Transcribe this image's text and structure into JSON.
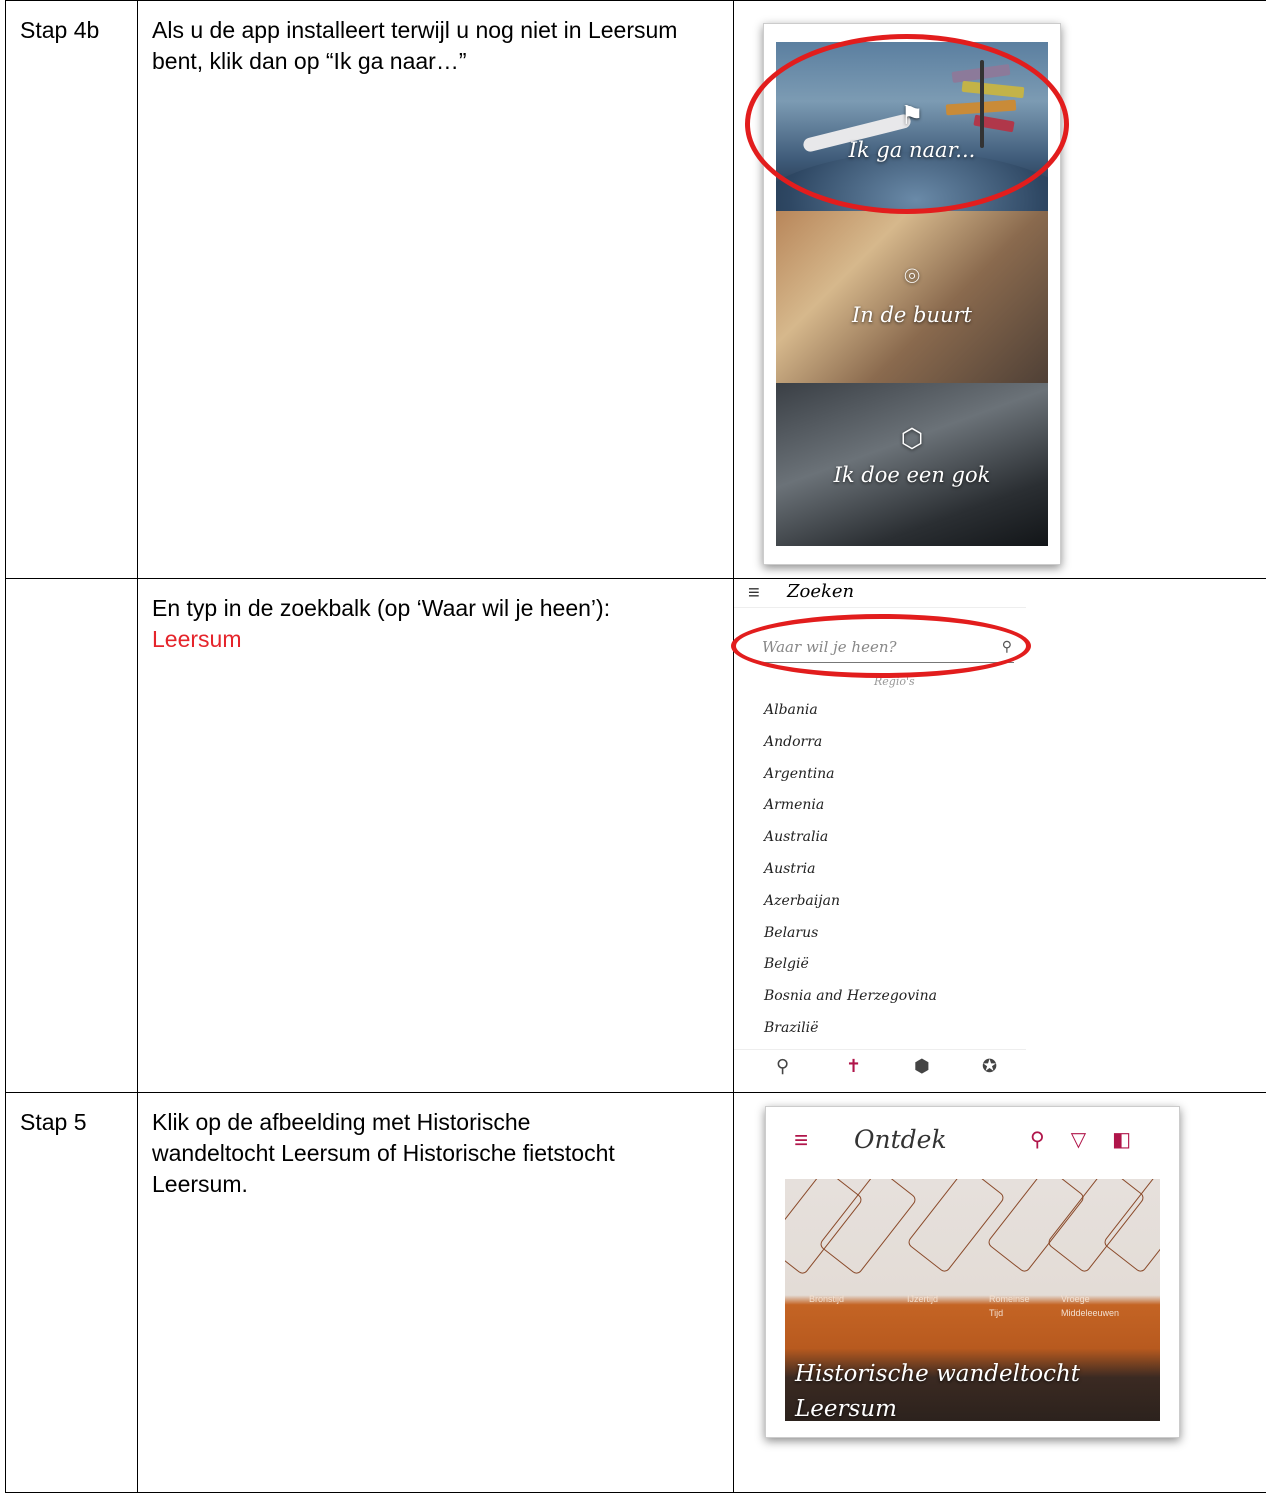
{
  "rows": [
    {
      "step": "Stap 4b",
      "instruction": "Als u de app installeert terwijl u nog niet in Leersum bent, klik dan op “Ik ga naar…”",
      "panels": [
        {
          "label": "Ik ga naar...",
          "icon": "signpost-icon"
        },
        {
          "label": "In de buurt",
          "icon": "location-pin-icon"
        },
        {
          "label": "Ik doe een gok",
          "icon": "dice-icon"
        }
      ]
    },
    {
      "step": "",
      "instruction": "En typ in de zoekbalk (op ‘Waar wil je heen’):",
      "highlight": "Leersum",
      "highlight_color": "#e5242b",
      "screen_title": "Zoeken",
      "search_placeholder": "Waar wil je heen?",
      "section_label": "Regio's",
      "countries": [
        "Albania",
        "Andorra",
        "Argentina",
        "Armenia",
        "Australia",
        "Austria",
        "Azerbaijan",
        "Belarus",
        "België",
        "Bosnia and Herzegovina",
        "Brazilië"
      ]
    },
    {
      "step": "Stap 5",
      "instruction": "Klik op de afbeelding met Historische wandeltocht Leersum of Historische fietstocht Leersum.",
      "screen_title": "Ontdek",
      "eras": [
        "Bronstijd",
        "IJzertijd",
        "Romeinse",
        "Vroege",
        "Tijd",
        "Middeleeuwen"
      ],
      "tour_title_1": "Historische wandeltocht",
      "tour_title_2": "Leersum"
    }
  ],
  "accent_color": "#b0154a",
  "ellipse_color": "#e21d1d"
}
